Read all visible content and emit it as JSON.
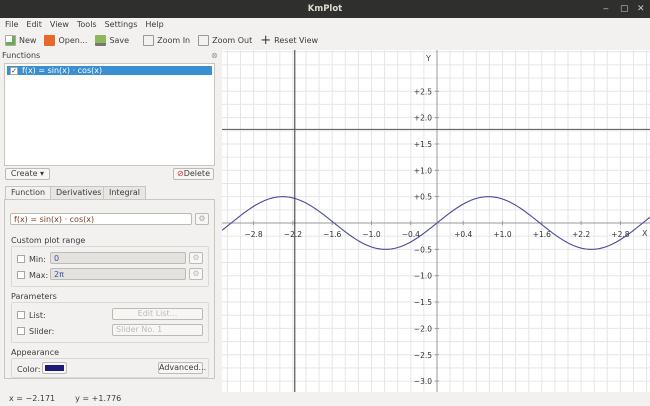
{
  "window": {
    "title": "KmPlot",
    "controls": [
      "‒",
      "▢",
      "✕"
    ]
  },
  "menu": [
    "File",
    "Edit",
    "View",
    "Tools",
    "Settings",
    "Help"
  ],
  "toolbar": {
    "new": "New",
    "open": "Open...",
    "save": "Save",
    "zoom_in": "Zoom In",
    "zoom_out": "Zoom Out",
    "reset_view": "Reset View"
  },
  "functions_panel": {
    "title": "Functions",
    "items": [
      {
        "label": "f(x) = sin(x) · cos(x)",
        "checked": true
      }
    ],
    "create": "Create",
    "delete": "Delete"
  },
  "tabs": [
    "Function",
    "Derivatives",
    "Integral"
  ],
  "function_tab": {
    "equation": "f(x) = sin(x) · cos(x)",
    "custom_plot_range": "Custom plot range",
    "min_label": "Min:",
    "min_value": "0",
    "max_label": "Max:",
    "max_value": "2π",
    "parameters": "Parameters",
    "list_label": "List:",
    "edit_list": "Edit List...",
    "slider_label": "Slider:",
    "slider_value": "Slider No. 1",
    "appearance": "Appearance",
    "color_label": "Color:",
    "color": "#1a1a7a",
    "advanced": "Advanced..."
  },
  "status": {
    "x": "x = −2.171",
    "y": "y = +1.776"
  },
  "chart_data": {
    "type": "line",
    "function": "sin(x)*cos(x)",
    "xlabel": "X",
    "ylabel": "Y",
    "xlim": [
      -3.28,
      3.26
    ],
    "ylim": [
      -3.2,
      3.3
    ],
    "x_ticks": [
      "−2.8",
      "−2.2",
      "−1.6",
      "−1.0",
      "−0.4",
      "+0.4",
      "+1.0",
      "+1.6",
      "+2.2",
      "+2.8"
    ],
    "y_ticks": [
      "+2.5",
      "+2.0",
      "+1.5",
      "+1.0",
      "+0.5",
      "−0.5",
      "−1.0",
      "−1.5",
      "−2.0",
      "−2.5",
      "−3.0"
    ],
    "crosshair": {
      "x": -2.171,
      "y": 1.776
    },
    "line_color": "#4a4a9a"
  }
}
